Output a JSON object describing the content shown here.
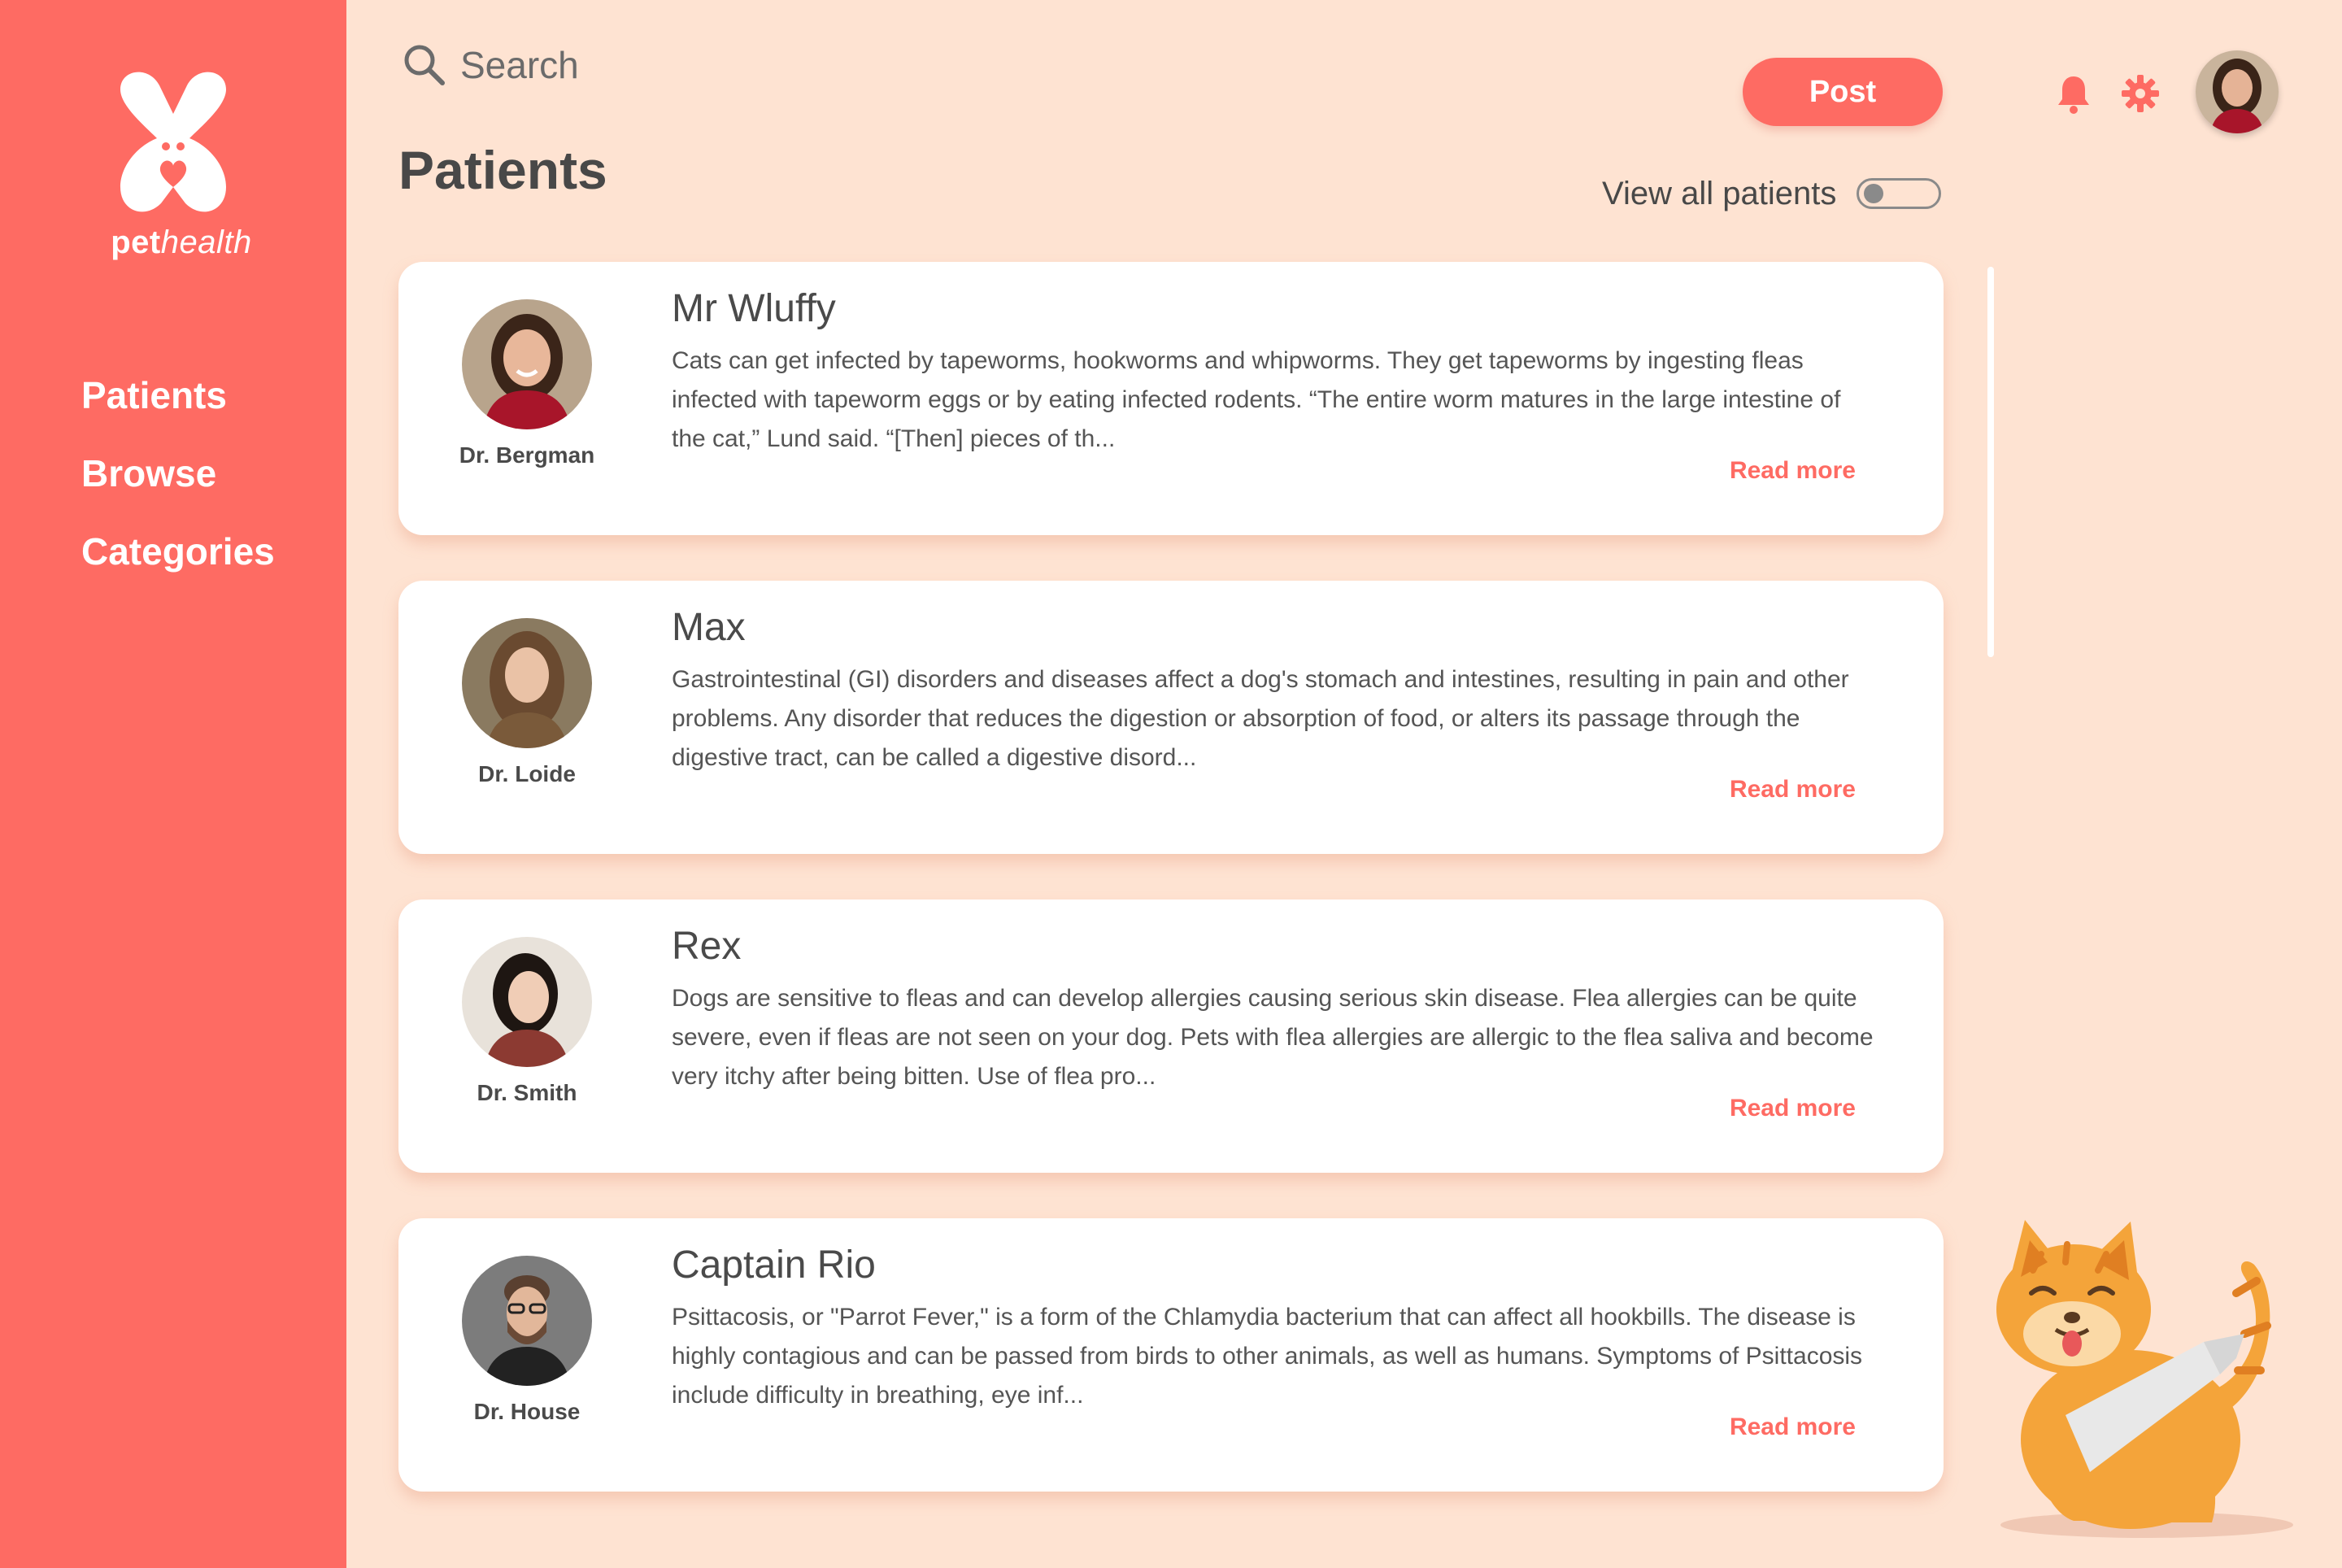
{
  "brand": {
    "name_bold": "pet",
    "name_italic": "health",
    "color": "#fe6b63"
  },
  "sidebar": {
    "items": [
      {
        "label": "Patients"
      },
      {
        "label": "Browse"
      },
      {
        "label": "Categories"
      }
    ]
  },
  "header": {
    "search_placeholder": "Search",
    "post_label": "Post",
    "icons": [
      "search-icon",
      "bell-icon",
      "gear-icon"
    ]
  },
  "page": {
    "title": "Patients",
    "toggle_label": "View all patients",
    "toggle_on": false
  },
  "patients": [
    {
      "name": "Mr Wluffy",
      "doctor": "Dr. Bergman",
      "excerpt": "Cats can get infected by tapeworms, hookworms and whipworms. They get tapeworms by ingesting fleas infected with tapeworm eggs or by eating infected rodents. “The entire worm matures in the large intestine of the cat,” Lund said. “[Then] pieces of th...",
      "read_more": "Read more"
    },
    {
      "name": "Max",
      "doctor": "Dr. Loide",
      "excerpt": "Gastrointestinal (GI) disorders and diseases affect a dog's stomach and intestines, resulting in pain and other problems. Any disorder that reduces the digestion or absorption of food, or alters its passage through the digestive tract, can be called a digestive disord...",
      "read_more": "Read more"
    },
    {
      "name": "Rex",
      "doctor": "Dr. Smith",
      "excerpt": "Dogs are sensitive to fleas and can develop allergies causing serious skin disease. Flea allergies can be quite severe, even if fleas are not seen on your dog. Pets with flea allergies are allergic to the flea saliva and become very itchy after being bitten. Use of flea pro...",
      "read_more": "Read more"
    },
    {
      "name": "Captain Rio",
      "doctor": "Dr. House",
      "excerpt": "Psittacosis, or \"Parrot Fever,\" is a form of the Chlamydia bacterium that can affect all hookbills. The disease is highly contagious and can be passed from birds to other animals, as well as humans. Symptoms of Psittacosis include difficulty in breathing, eye inf...",
      "read_more": "Read more"
    }
  ],
  "colors": {
    "accent": "#fe6b63",
    "background": "#fee3d2",
    "card": "#ffffff"
  }
}
